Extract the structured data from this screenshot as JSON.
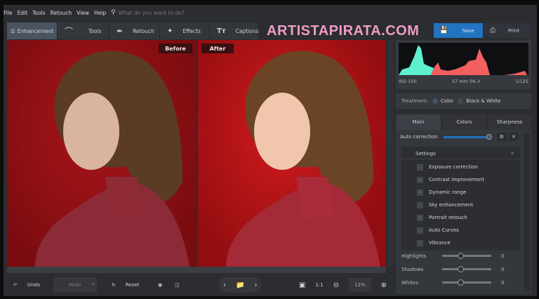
{
  "menu": {
    "items": [
      "File",
      "Edit",
      "Tools",
      "Retouch",
      "View",
      "Help"
    ],
    "search_placeholder": "What do you want to do?"
  },
  "toolbar": {
    "tabs": [
      {
        "label": "Enhancement",
        "icon": "sliders-icon"
      },
      {
        "label": "Tools",
        "icon": "crop-icon"
      },
      {
        "label": "Retouch",
        "icon": "brush-icon"
      },
      {
        "label": "Effects",
        "icon": "magic-wand-icon"
      },
      {
        "label": "Captions",
        "icon": "text-icon"
      }
    ],
    "save": "Save",
    "print": "Print"
  },
  "watermark": "ARTISTAPIRATA.COM",
  "viewer": {
    "before": "Before",
    "after": "After"
  },
  "histogram": {
    "iso": "ISO 100",
    "lens": "57 mm f/6.3",
    "shutter": "1/125"
  },
  "treatment": {
    "label": "Treatment:",
    "options": [
      "Color",
      "Black & White"
    ],
    "selected": "Color"
  },
  "panel_tabs": [
    "Main",
    "Colors",
    "Sharpness"
  ],
  "auto_correction": {
    "label": "Auto correction",
    "value": 100
  },
  "settings": {
    "title": "Settings",
    "items": [
      {
        "label": "Exposure correction",
        "checked": false
      },
      {
        "label": "Contrast improvement",
        "checked": true
      },
      {
        "label": "Dynamic range",
        "checked": true
      },
      {
        "label": "Sky enhancement",
        "checked": false
      },
      {
        "label": "Portrait retouch",
        "checked": true
      },
      {
        "label": "Auto Curves",
        "checked": false
      },
      {
        "label": "Vibrance",
        "checked": false
      }
    ]
  },
  "sliders": [
    {
      "label": "Highlights",
      "value": "0"
    },
    {
      "label": "Shadows",
      "value": "0"
    },
    {
      "label": "Whites",
      "value": "0"
    }
  ],
  "bottom": {
    "undo": "Undo",
    "redo": "Redo",
    "reset": "Reset",
    "zoom_1_1": "1:1",
    "zoom": "12%"
  },
  "colors": {
    "accent": "#2273c0",
    "bg": "#2b2d31",
    "photo_red": "#a8141a"
  }
}
